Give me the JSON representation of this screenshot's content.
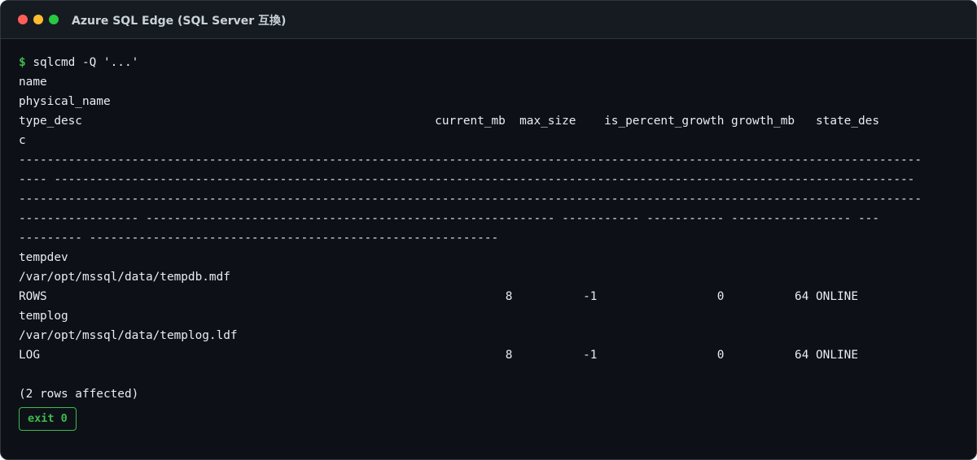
{
  "window": {
    "title": "Azure SQL Edge (SQL Server 互換)"
  },
  "terminal": {
    "prompt_symbol": "$",
    "command": "sqlcmd -Q '...'",
    "output_lines": [
      "name",
      "physical_name",
      "type_desc                                                  current_mb  max_size    is_percent_growth growth_mb   state_des",
      "c",
      "--------------------------------------------------------------------------------------------------------------------------------",
      "---- --------------------------------------------------------------------------------------------------------------------------",
      "--------------------------------------------------------------------------------------------------------------------------------",
      "----------------- ---------------------------------------------------------- ----------- ----------- ----------------- ---",
      "--------- ----------------------------------------------------------",
      "tempdev",
      "/var/opt/mssql/data/tempdb.mdf",
      "ROWS                                                                 8          -1                 0          64 ONLINE",
      "templog",
      "/var/opt/mssql/data/templog.ldf",
      "LOG                                                                  8          -1                 0          64 ONLINE"
    ],
    "summary": "(2 rows affected)",
    "exit_badge": "exit 0"
  },
  "colors": {
    "background": "#0d1117",
    "titlebar": "#161b22",
    "text": "#e6edf3",
    "prompt": "#3fb950",
    "close": "#ff5f57",
    "minimize": "#febc2e",
    "maximize": "#28c840"
  }
}
